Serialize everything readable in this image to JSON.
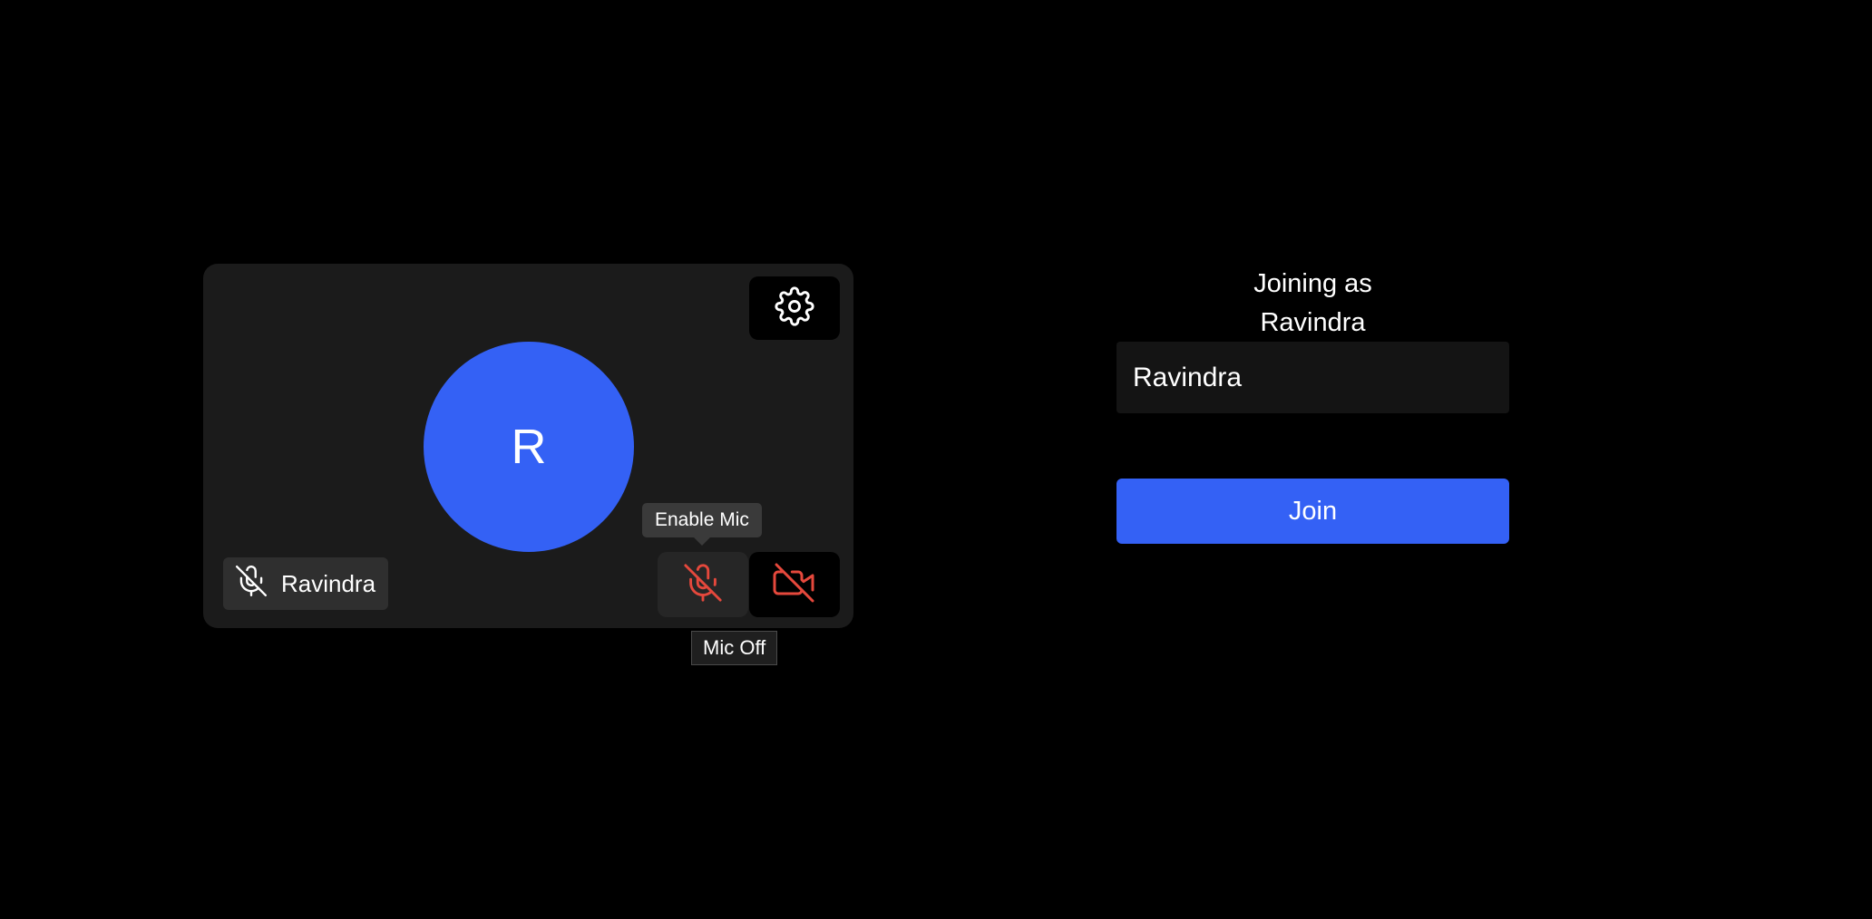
{
  "preview": {
    "avatar_initial": "R",
    "participant_name": "Ravindra",
    "mic_tooltip": "Enable Mic",
    "mic_status_label": "Mic Off",
    "mic_state": "off",
    "camera_state": "off"
  },
  "join_panel": {
    "title_line1": "Joining as",
    "title_line2": "Ravindra",
    "name_input_value": "Ravindra",
    "join_label": "Join"
  },
  "colors": {
    "background": "#000000",
    "tile": "#1b1b1b",
    "accent": "#3461f5",
    "muted_red": "#e5483c"
  },
  "icons": {
    "settings": "gear-icon",
    "badge_mic": "mic-off-icon",
    "mic_button": "mic-off-icon",
    "camera_button": "video-off-icon"
  }
}
